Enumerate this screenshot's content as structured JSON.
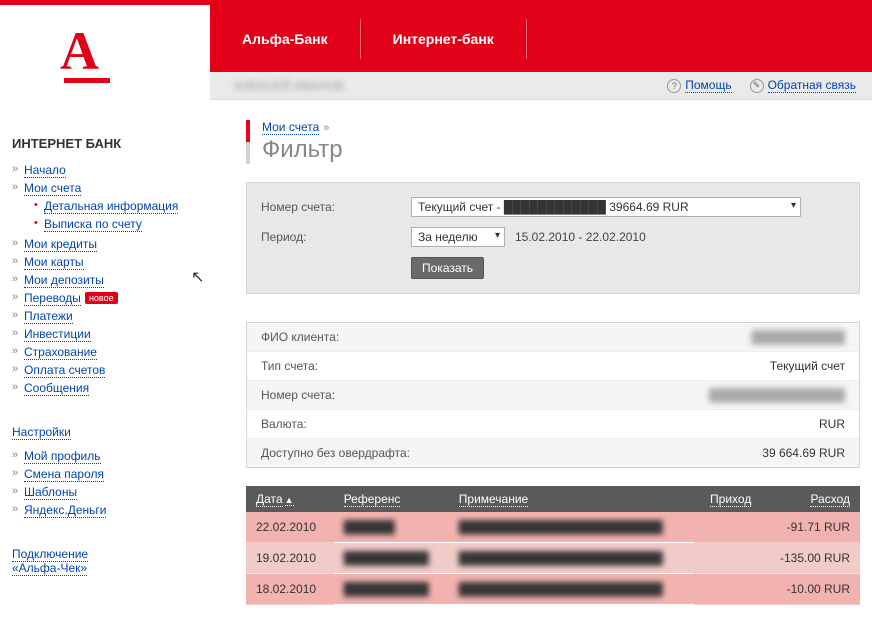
{
  "header": {
    "logo_letter": "A",
    "tab1": "Альфа-Банк",
    "tab2": "Интернет-банк",
    "user_blurred": "АЛЕКСЕЙ ИВАНОВ",
    "help": "Помощь",
    "feedback": "Обратная связь"
  },
  "sidebar": {
    "title": "ИНТЕРНЕТ БАНК",
    "items": [
      {
        "label": "Начало"
      },
      {
        "label": "Мои счета",
        "sub": [
          {
            "label": "Детальная информация"
          },
          {
            "label": "Выписка по счету"
          }
        ]
      },
      {
        "label": "Мои кредиты"
      },
      {
        "label": "Мои карты"
      },
      {
        "label": "Мои депозиты"
      },
      {
        "label": "Переводы",
        "badge": "новое"
      },
      {
        "label": "Платежи"
      },
      {
        "label": "Инвестиции"
      },
      {
        "label": "Страхование"
      },
      {
        "label": "Оплата счетов"
      },
      {
        "label": "Сообщения"
      }
    ],
    "settings_title": "Настройки",
    "settings": [
      {
        "label": "Мой профиль"
      },
      {
        "label": "Смена пароля"
      },
      {
        "label": "Шаблоны"
      },
      {
        "label": "Яндекс.Деньги"
      }
    ],
    "bottom_link1": "Подключение",
    "bottom_link2": "«Альфа-Чек»"
  },
  "breadcrumb": {
    "parent": "Мои счета",
    "title": "Фильтр"
  },
  "filter": {
    "acct_label": "Номер счета:",
    "acct_value": "Текущий счет - ████████████  39664.69 RUR",
    "period_label": "Период:",
    "period_value": "За неделю",
    "period_range": "15.02.2010 - 22.02.2010",
    "show_btn": "Показать"
  },
  "info": {
    "rows": [
      {
        "label": "ФИО клиента:",
        "value": "███████████",
        "blur": true
      },
      {
        "label": "Тип счета:",
        "value": "Текущий счет"
      },
      {
        "label": "Номер счета:",
        "value": "████████████████",
        "blur": true
      },
      {
        "label": "Валюта:",
        "value": "RUR"
      },
      {
        "label": "Доступно без овердрафта:",
        "value": "39 664.69 RUR"
      }
    ]
  },
  "table": {
    "headers": {
      "date": "Дата",
      "ref": "Референс",
      "note": "Примечание",
      "in": "Приход",
      "out": "Расход"
    },
    "rows": [
      {
        "date": "22.02.2010",
        "ref": "██████",
        "note": "████████████████████████",
        "in": "",
        "out": "-91.71 RUR"
      },
      {
        "date": "19.02.2010",
        "ref": "██████████",
        "note": "████████████████████████",
        "in": "",
        "out": "-135.00 RUR"
      },
      {
        "date": "18.02.2010",
        "ref": "██████████",
        "note": "████████████████████████",
        "in": "",
        "out": "-10.00 RUR"
      }
    ]
  }
}
